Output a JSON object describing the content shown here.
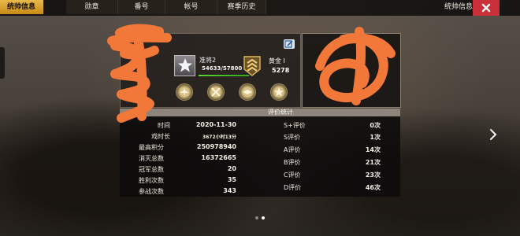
{
  "tabs": [
    {
      "label": "统帅信息",
      "active": true
    },
    {
      "label": "勋章",
      "active": false
    },
    {
      "label": "番号",
      "active": false
    },
    {
      "label": "帐号",
      "active": false
    },
    {
      "label": "赛季历史",
      "active": false
    }
  ],
  "header": {
    "title": "统帅信息",
    "close_icon": "close-icon"
  },
  "profile": {
    "rank_name": "准将2",
    "exp_text": "54633/57800",
    "exp_fraction": 0.945,
    "tier_name": "黄金 I",
    "tier_score": "5278",
    "medal_icons": [
      "winged-medal-icon",
      "crossed-swords-icon",
      "eagle-medal-icon",
      "star-medal-icon"
    ]
  },
  "stats": {
    "rows": [
      {
        "label": "时间",
        "value": "2020-11-30"
      },
      {
        "label": "戏时长",
        "value": "3672小时13分"
      },
      {
        "label": "最高积分",
        "value": "250978940"
      },
      {
        "label": "消灭总数",
        "value": "16372665"
      },
      {
        "label": "冠军总数",
        "value": "20"
      },
      {
        "label": "胜利次数",
        "value": "35"
      },
      {
        "label": "参战次数",
        "value": "343"
      }
    ]
  },
  "evaluation": {
    "title": "评价统计",
    "rows": [
      {
        "label": "S+评价",
        "value": "0次"
      },
      {
        "label": "S评价",
        "value": "1次"
      },
      {
        "label": "A评价",
        "value": "14次"
      },
      {
        "label": "B评价",
        "value": "21次"
      },
      {
        "label": "C评价",
        "value": "23次"
      },
      {
        "label": "D评价",
        "value": "46次"
      }
    ]
  },
  "pagination": {
    "count": 2,
    "current": 2
  },
  "colors": {
    "accent": "#e0a83a",
    "close": "#c9303a",
    "redaction": "#f2783a",
    "exp_bar": "#4cc22a"
  }
}
